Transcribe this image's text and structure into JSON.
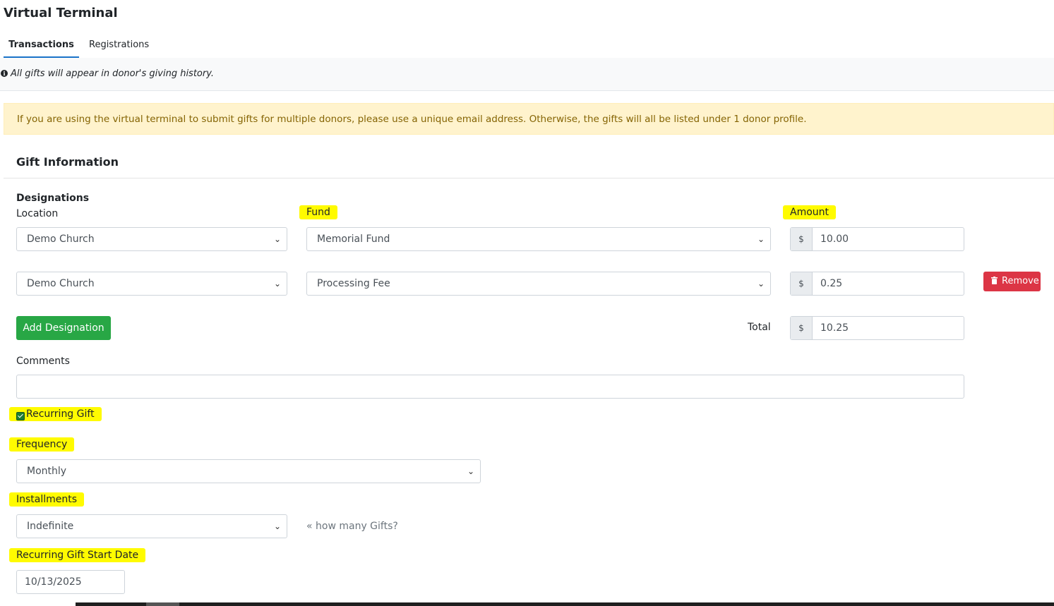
{
  "page": {
    "title": "Virtual Terminal"
  },
  "tabs": [
    {
      "label": "Transactions",
      "active": true
    },
    {
      "label": "Registrations",
      "active": false
    }
  ],
  "info_note": "All gifts will appear in donor's giving history.",
  "alert": "If you are using the virtual terminal to submit gifts for multiple donors, please use a unique email address. Otherwise, the gifts will all be listed under 1 donor profile.",
  "gift_info": {
    "title": "Gift Information",
    "designations_label": "Designations",
    "location_label": "Location",
    "fund_label": "Fund",
    "amount_label": "Amount",
    "currency_symbol": "$",
    "rows": [
      {
        "location": "Demo Church",
        "fund": "Memorial Fund",
        "amount": "10.00"
      },
      {
        "location": "Demo Church",
        "fund": "Processing Fee",
        "amount": "0.25"
      }
    ],
    "remove_label": "Remove",
    "add_designation_label": "Add Designation",
    "total_label": "Total",
    "total_value": "10.25",
    "comments_label": "Comments",
    "comments_value": "",
    "recurring_label": "Recurring Gift",
    "recurring_checked": true,
    "frequency_label": "Frequency",
    "frequency_value": "Monthly",
    "installments_label": "Installments",
    "installments_value": "Indefinite",
    "installments_hint": "« how many Gifts?",
    "start_date_label": "Recurring Gift Start Date",
    "start_date_value": "10/13/2025"
  },
  "colors": {
    "highlight": "#fffb00",
    "tab_active": "#1a73c8",
    "alert_bg": "#fff3cd",
    "alert_text": "#856404",
    "remove_button": "#dc3545",
    "add_button": "#28a745"
  }
}
